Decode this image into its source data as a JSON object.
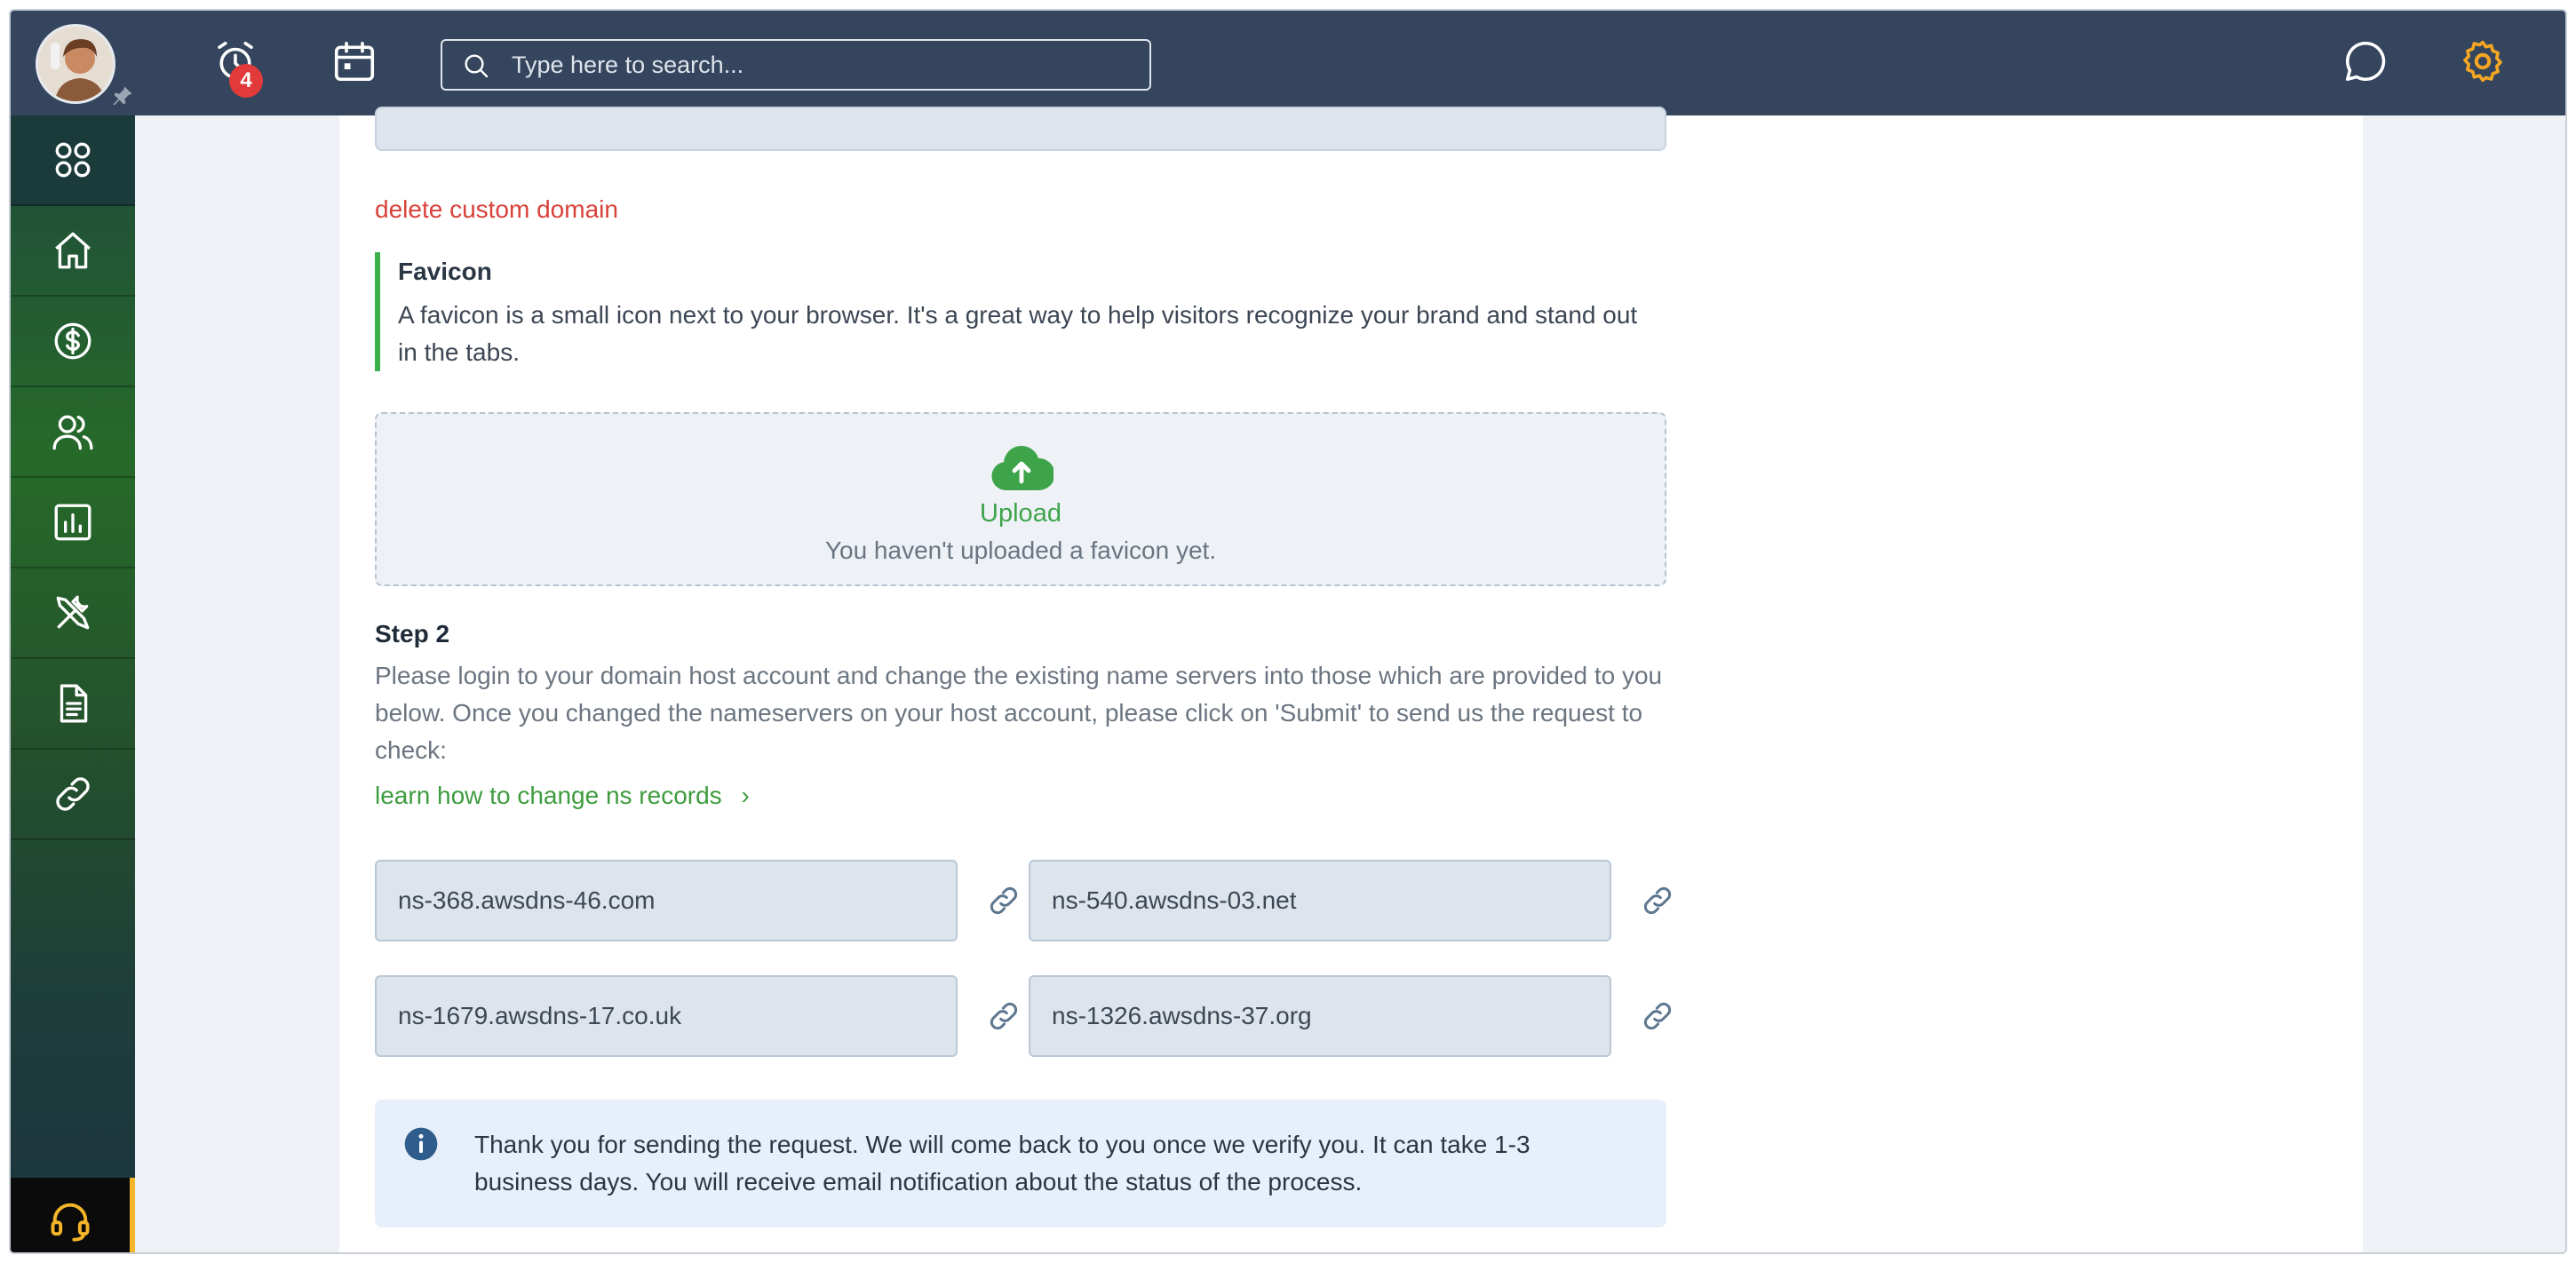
{
  "topbar": {
    "notification_count": "4",
    "search_placeholder": "Type here to search..."
  },
  "sidebar": {
    "items": [
      "apps",
      "home",
      "billing",
      "users",
      "reports",
      "tools",
      "documents",
      "links"
    ]
  },
  "content": {
    "delete_link": "delete custom domain",
    "favicon_title": "Favicon",
    "favicon_desc": "A favicon is a small icon next to your browser. It's a great way to help visitors recognize your brand and stand out in the tabs.",
    "upload_label": "Upload",
    "upload_note": "You haven't uploaded a favicon yet.",
    "step_title": "Step 2",
    "step_desc": "Please login to your domain host account and change the existing name servers into those which are provided to you below. Once you changed the nameservers on your host account, please click on 'Submit' to send us the request to check:",
    "learn_link": "learn how to change ns records",
    "nameservers": [
      "ns-368.awsdns-46.com",
      "ns-540.awsdns-03.net",
      "ns-1679.awsdns-17.co.uk",
      "ns-1326.awsdns-37.org"
    ],
    "info_text": "Thank you for sending the request. We will come back to you once we verify you. It can take 1-3 business days. You will receive email notification about the status of the process."
  },
  "colors": {
    "topbar": "#34455d",
    "accent_green": "#3ea44a",
    "danger": "#d8423a",
    "settings_icon": "#f5a623"
  }
}
